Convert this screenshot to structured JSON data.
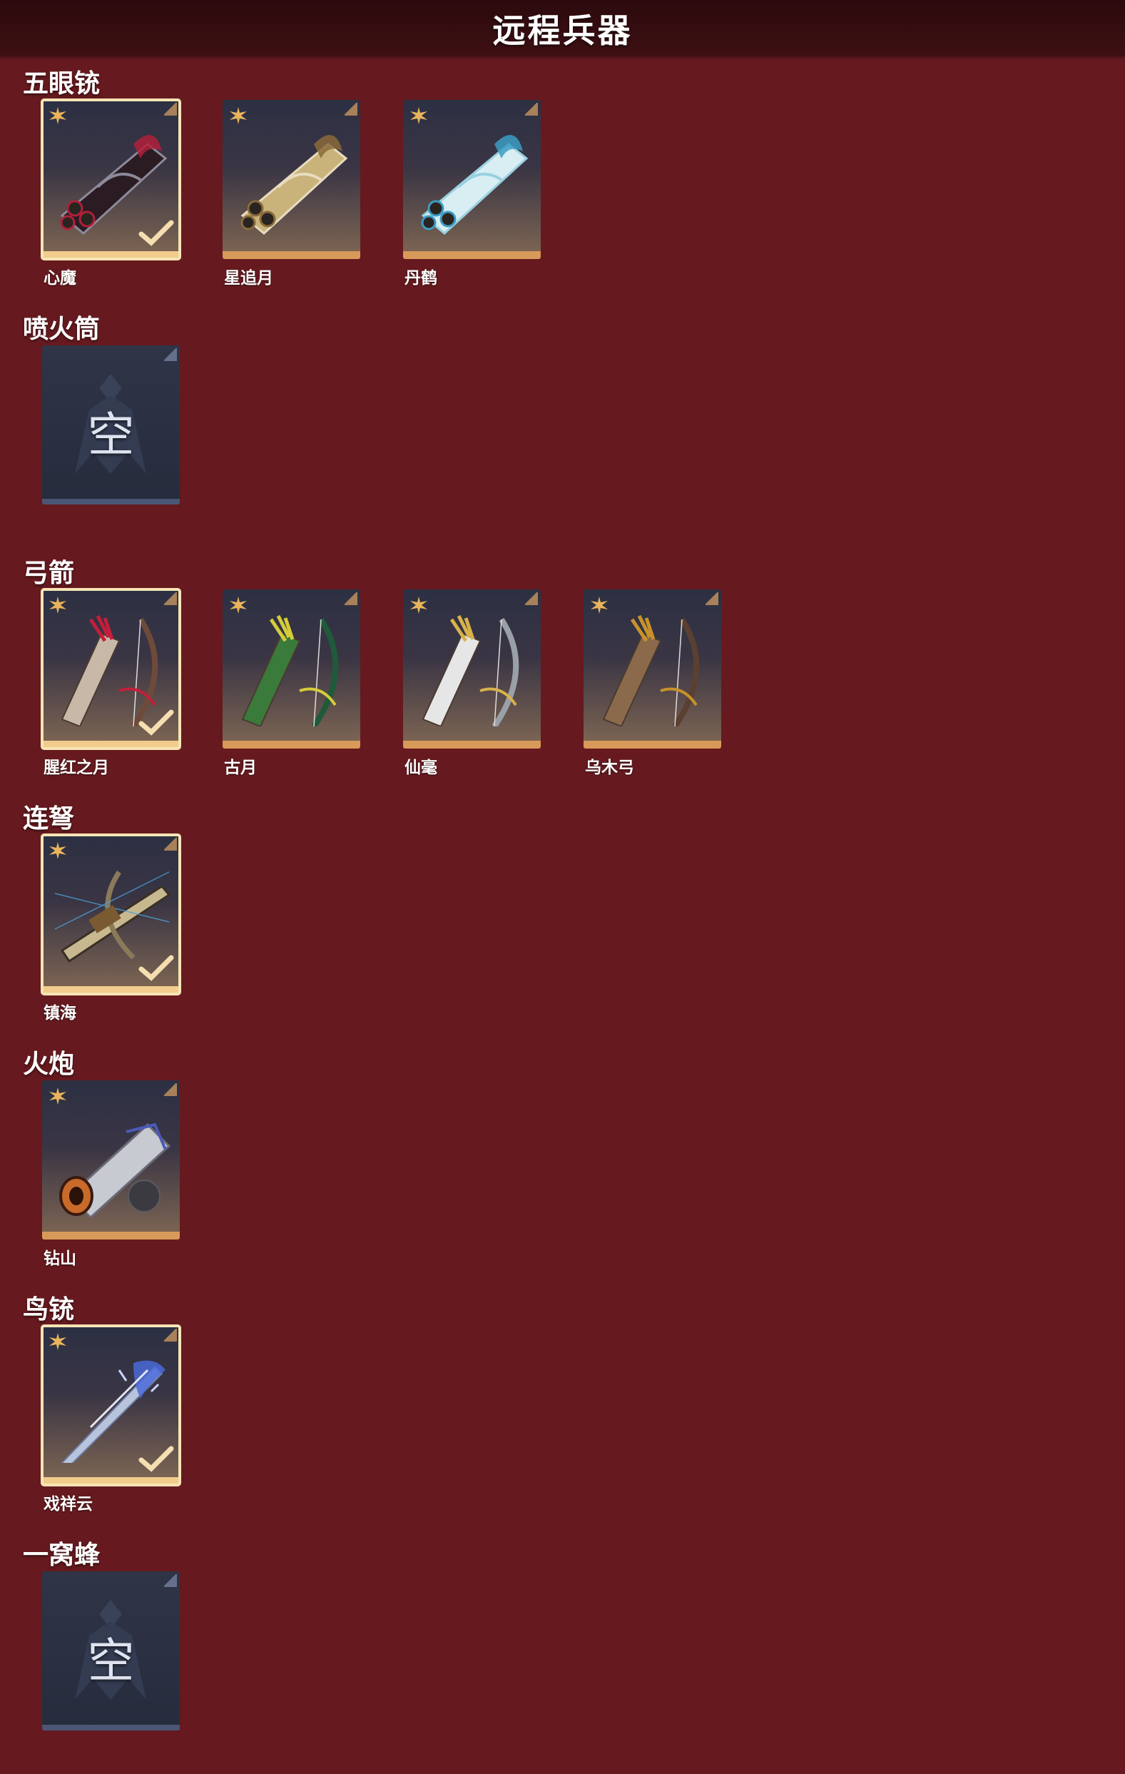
{
  "header": {
    "title": "远程兵器"
  },
  "sections": [
    {
      "category": "五眼铳",
      "items": [
        {
          "name": "心魔",
          "selected": true,
          "icon": "five-barrel-gun-icon"
        },
        {
          "name": "星追月",
          "selected": false,
          "icon": "five-barrel-gun-icon"
        },
        {
          "name": "丹鹤",
          "selected": false,
          "icon": "five-barrel-gun-icon"
        }
      ]
    },
    {
      "category": "喷火筒",
      "items": [
        {
          "name": "",
          "empty_label": "空",
          "empty": true
        }
      ]
    },
    {
      "category": "弓箭",
      "items": [
        {
          "name": "腥红之月",
          "selected": true,
          "icon": "bow-quiver-icon"
        },
        {
          "name": "古月",
          "selected": false,
          "icon": "bow-quiver-icon"
        },
        {
          "name": "仙毫",
          "selected": false,
          "icon": "bow-quiver-icon"
        },
        {
          "name": "乌木弓",
          "selected": false,
          "icon": "bow-quiver-icon"
        }
      ]
    },
    {
      "category": "连弩",
      "items": [
        {
          "name": "镇海",
          "selected": true,
          "icon": "crossbow-icon"
        }
      ]
    },
    {
      "category": "火炮",
      "items": [
        {
          "name": "钻山",
          "selected": false,
          "icon": "cannon-icon"
        }
      ]
    },
    {
      "category": "鸟铳",
      "items": [
        {
          "name": "戏祥云",
          "selected": true,
          "icon": "musket-icon"
        }
      ]
    },
    {
      "category": "一窝蜂",
      "items": [
        {
          "name": "",
          "empty_label": "空",
          "empty": true
        }
      ]
    }
  ],
  "colors": {
    "background": "#661a1f",
    "header": "#2b0a0d",
    "selected_border": "#f7e4b5",
    "card_accent": "#d89a5a",
    "star": "#e9b45b"
  }
}
